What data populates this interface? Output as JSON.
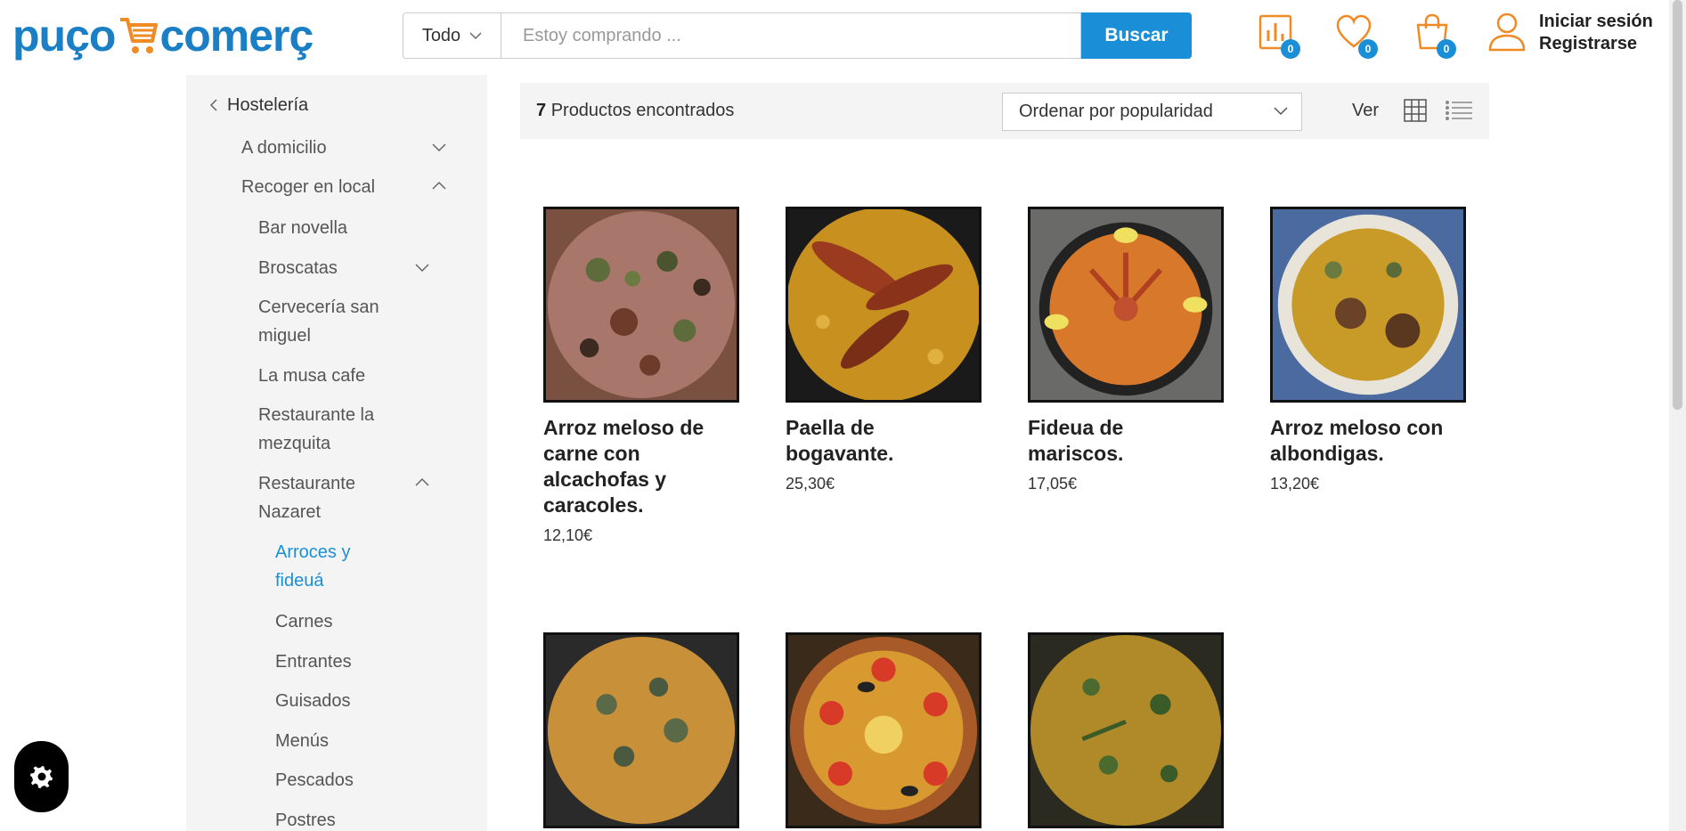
{
  "brand": {
    "name_left": "puço",
    "name_right": "comerç",
    "primary_color": "#1a7fc4",
    "accent_color": "#f08a24"
  },
  "search": {
    "category": "Todo",
    "placeholder": "Estoy comprando ...",
    "button": "Buscar"
  },
  "header_icons": [
    {
      "icon": "compare-chart-icon",
      "count": "0"
    },
    {
      "icon": "heart-icon",
      "count": "0"
    },
    {
      "icon": "shopping-bag-icon",
      "count": "0"
    }
  ],
  "account": {
    "login": "Iniciar sesión",
    "register": "Registrarse"
  },
  "sidebar": {
    "back_label": "Hostelería",
    "items": [
      {
        "label": "A domicilio",
        "chevron": "down"
      },
      {
        "label": "Recoger en local",
        "chevron": "up"
      },
      {
        "label": "Bar novella"
      },
      {
        "label": "Broscatas",
        "chevron": "down"
      },
      {
        "label": "Cervecería san miguel"
      },
      {
        "label": "La musa cafe"
      },
      {
        "label": "Restaurante la mezquita"
      },
      {
        "label": "Restaurante Nazaret",
        "chevron": "up"
      },
      {
        "label": "Arroces y fideuá",
        "active": true
      },
      {
        "label": "Carnes"
      },
      {
        "label": "Entrantes"
      },
      {
        "label": "Guisados"
      },
      {
        "label": "Menús"
      },
      {
        "label": "Pescados"
      },
      {
        "label": "Postres"
      }
    ]
  },
  "toolbar": {
    "count": "7",
    "count_label": "Productos encontrados",
    "sort": "Ordenar por popularidad",
    "view_label": "Ver"
  },
  "products": [
    {
      "name": "Arroz meloso de carne con alcachofas y caracoles.",
      "price": "12,10€"
    },
    {
      "name": "Paella de bogavante.",
      "price": "25,30€"
    },
    {
      "name": "Fideua de mariscos.",
      "price": "17,05€"
    },
    {
      "name": "Arroz meloso con albondigas.",
      "price": "13,20€"
    },
    {
      "name": "",
      "price": ""
    },
    {
      "name": "",
      "price": ""
    },
    {
      "name": "",
      "price": ""
    }
  ]
}
